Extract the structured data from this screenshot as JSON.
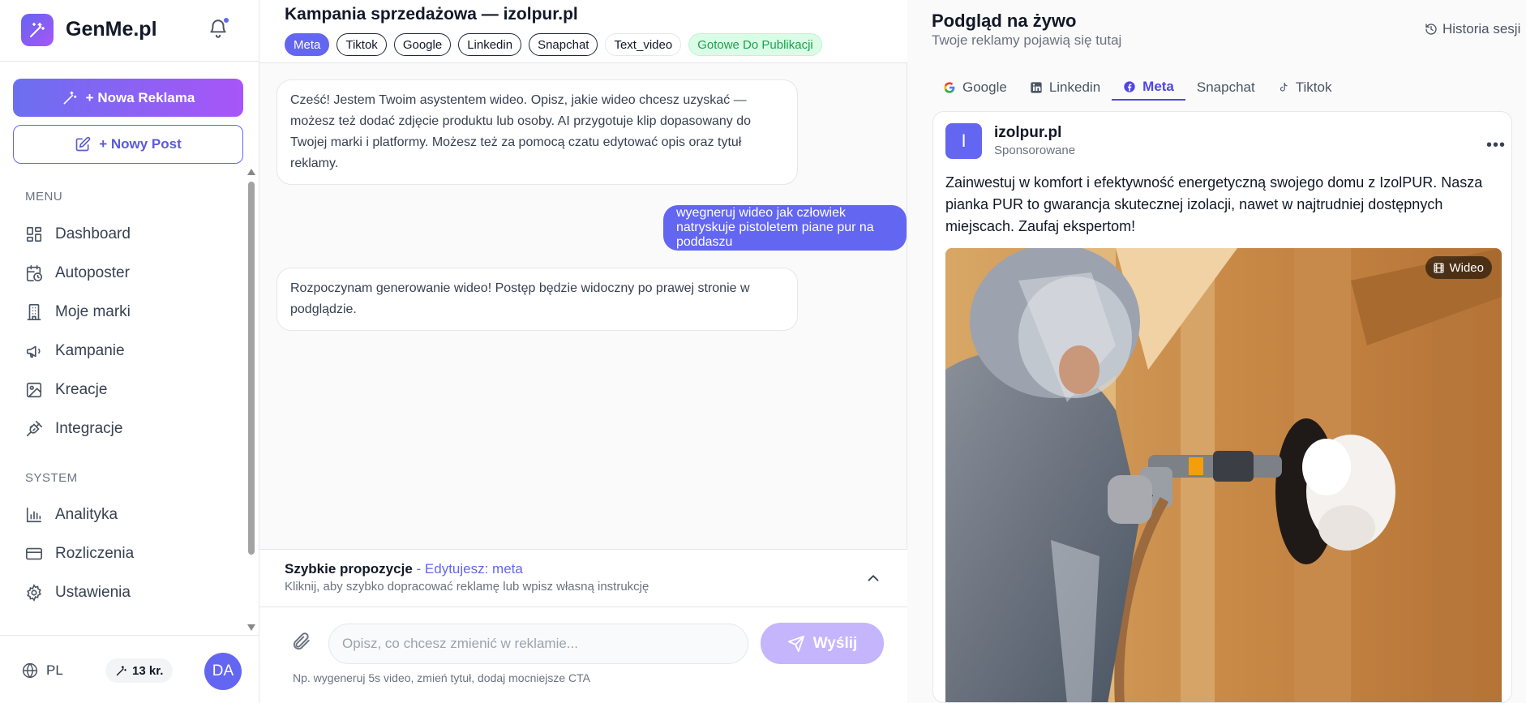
{
  "sidebar": {
    "brand": "GenMe.pl",
    "new_ad": "+ Nowa Reklama",
    "new_post": "+ Nowy Post",
    "menu_label": "MENU",
    "menu_items": [
      {
        "label": "Dashboard",
        "icon": "dashboard-icon"
      },
      {
        "label": "Autoposter",
        "icon": "calendar-clock-icon"
      },
      {
        "label": "Moje marki",
        "icon": "building-icon"
      },
      {
        "label": "Kampanie",
        "icon": "megaphone-icon"
      },
      {
        "label": "Kreacje",
        "icon": "image-icon"
      },
      {
        "label": "Integracje",
        "icon": "plug-icon"
      }
    ],
    "system_label": "SYSTEM",
    "system_items": [
      {
        "label": "Analityka",
        "icon": "bar-chart-icon"
      },
      {
        "label": "Rozliczenia",
        "icon": "credit-card-icon"
      },
      {
        "label": "Ustawienia",
        "icon": "gear-icon"
      }
    ],
    "footer": {
      "language": "PL",
      "credits": "13 kr.",
      "avatar": "DA"
    }
  },
  "chat": {
    "title": "Kampania sprzedażowa — izolpur.pl",
    "tags": [
      "Meta",
      "Tiktok",
      "Google",
      "Linkedin",
      "Snapchat",
      "Text_video",
      "Gotowe Do Publikacji"
    ],
    "messages": [
      {
        "role": "assistant",
        "text": "Cześć! Jestem Twoim asystentem wideo. Opisz, jakie wideo chcesz uzyskać — możesz też dodać zdjęcie produktu lub osoby. AI przygotuje klip dopasowany do Twojej marki i platformy. Możesz też za pomocą czatu edytować opis oraz tytuł reklamy."
      },
      {
        "role": "user",
        "text": "wyegneruj wideo jak człowiek natryskuje pistoletem piane pur na poddaszu"
      },
      {
        "role": "assistant",
        "text": "Rozpoczynam generowanie wideo! Postęp będzie widoczny po prawej stronie w podglądzie."
      }
    ],
    "quick": {
      "title": "Szybkie propozycje",
      "editing": "- Edytujesz: meta",
      "subtitle": "Kliknij, aby szybko dopracować reklamę lub wpisz własną instrukcję"
    },
    "composer": {
      "placeholder": "Opisz, co chcesz zmienić w reklamie...",
      "send": "Wyślij",
      "hint": "Np. wygeneruj 5s video, zmień tytuł, dodaj mocniejsze CTA"
    }
  },
  "preview": {
    "title": "Podgląd na żywo",
    "subtitle": "Twoje reklamy pojawią się tutaj",
    "history": "Historia sesji",
    "tabs": [
      "Google",
      "Linkedin",
      "Meta",
      "Snapchat",
      "Tiktok"
    ],
    "active_tab": "Meta",
    "card": {
      "avatar_letter": "I",
      "page_name": "izolpur.pl",
      "sponsored": "Sponsorowane",
      "text": "Zainwestuj w komfort i efektywność energetyczną swojego domu z IzolPUR. Nasza pianka PUR to gwarancja skutecznej izolacji, nawet w najtrudniej dostępnych miejscach. Zaufaj ekspertom!",
      "video_badge": "Wideo"
    }
  },
  "colors": {
    "accent": "#6366f1",
    "accent_light": "#c4b5fd",
    "ready_green": "#16a34a"
  }
}
